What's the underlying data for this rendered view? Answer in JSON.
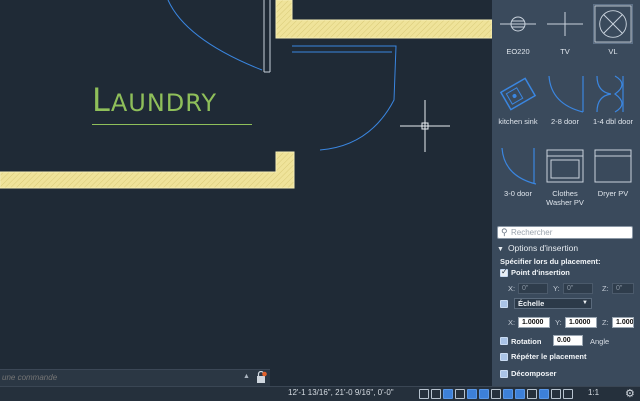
{
  "canvas": {
    "room_label": "Laundry"
  },
  "command_line": {
    "placeholder": "une commande"
  },
  "status_bar": {
    "coordinates": "12'-1 13/16\", 21'-0 9/16\", 0'-0\"",
    "scale": "1:1"
  },
  "palette": {
    "tiles": [
      {
        "label": "EO220",
        "icon": "outlet-icon"
      },
      {
        "label": "TV",
        "icon": "tv-icon"
      },
      {
        "label": "VL",
        "icon": "vl-icon"
      },
      {
        "label": "kitchen sink",
        "icon": "sink-icon"
      },
      {
        "label": "2-8 door",
        "icon": "door-icon"
      },
      {
        "label": "1-4 dbl door",
        "icon": "double-door-icon"
      },
      {
        "label": "3-0 door",
        "icon": "door-icon"
      },
      {
        "label": "Clothes Washer PV",
        "icon": "washer-icon"
      },
      {
        "label": "Dryer PV",
        "icon": "dryer-icon"
      }
    ],
    "search_placeholder": "Rechercher",
    "insertion_options": {
      "title": "Options d'insertion",
      "specify_label": "Spécifier lors du placement:",
      "insertion_point": {
        "label": "Point d'insertion",
        "checked": true,
        "x": "0\"",
        "y": "0\"",
        "z": "0\""
      },
      "scale": {
        "label": "Échelle",
        "checked": false,
        "x": "1.0000",
        "y": "1.0000",
        "z": "1.000"
      },
      "rotation": {
        "label": "Rotation",
        "checked": false,
        "value": "0.00",
        "unit_label": "Angle"
      },
      "repeat": {
        "label": "Répéter le placement",
        "checked": false
      },
      "explode": {
        "label": "Décomposer",
        "checked": false
      }
    },
    "axis_labels": {
      "x": "X:",
      "y": "Y:",
      "z": "Z:"
    }
  },
  "colors": {
    "canvas_bg": "#1f2a36",
    "wall_fill": "#efe39a",
    "door_swing": "#3a86e0",
    "room_text": "#8fbf5a",
    "palette_bg": "#3a4a5c"
  }
}
